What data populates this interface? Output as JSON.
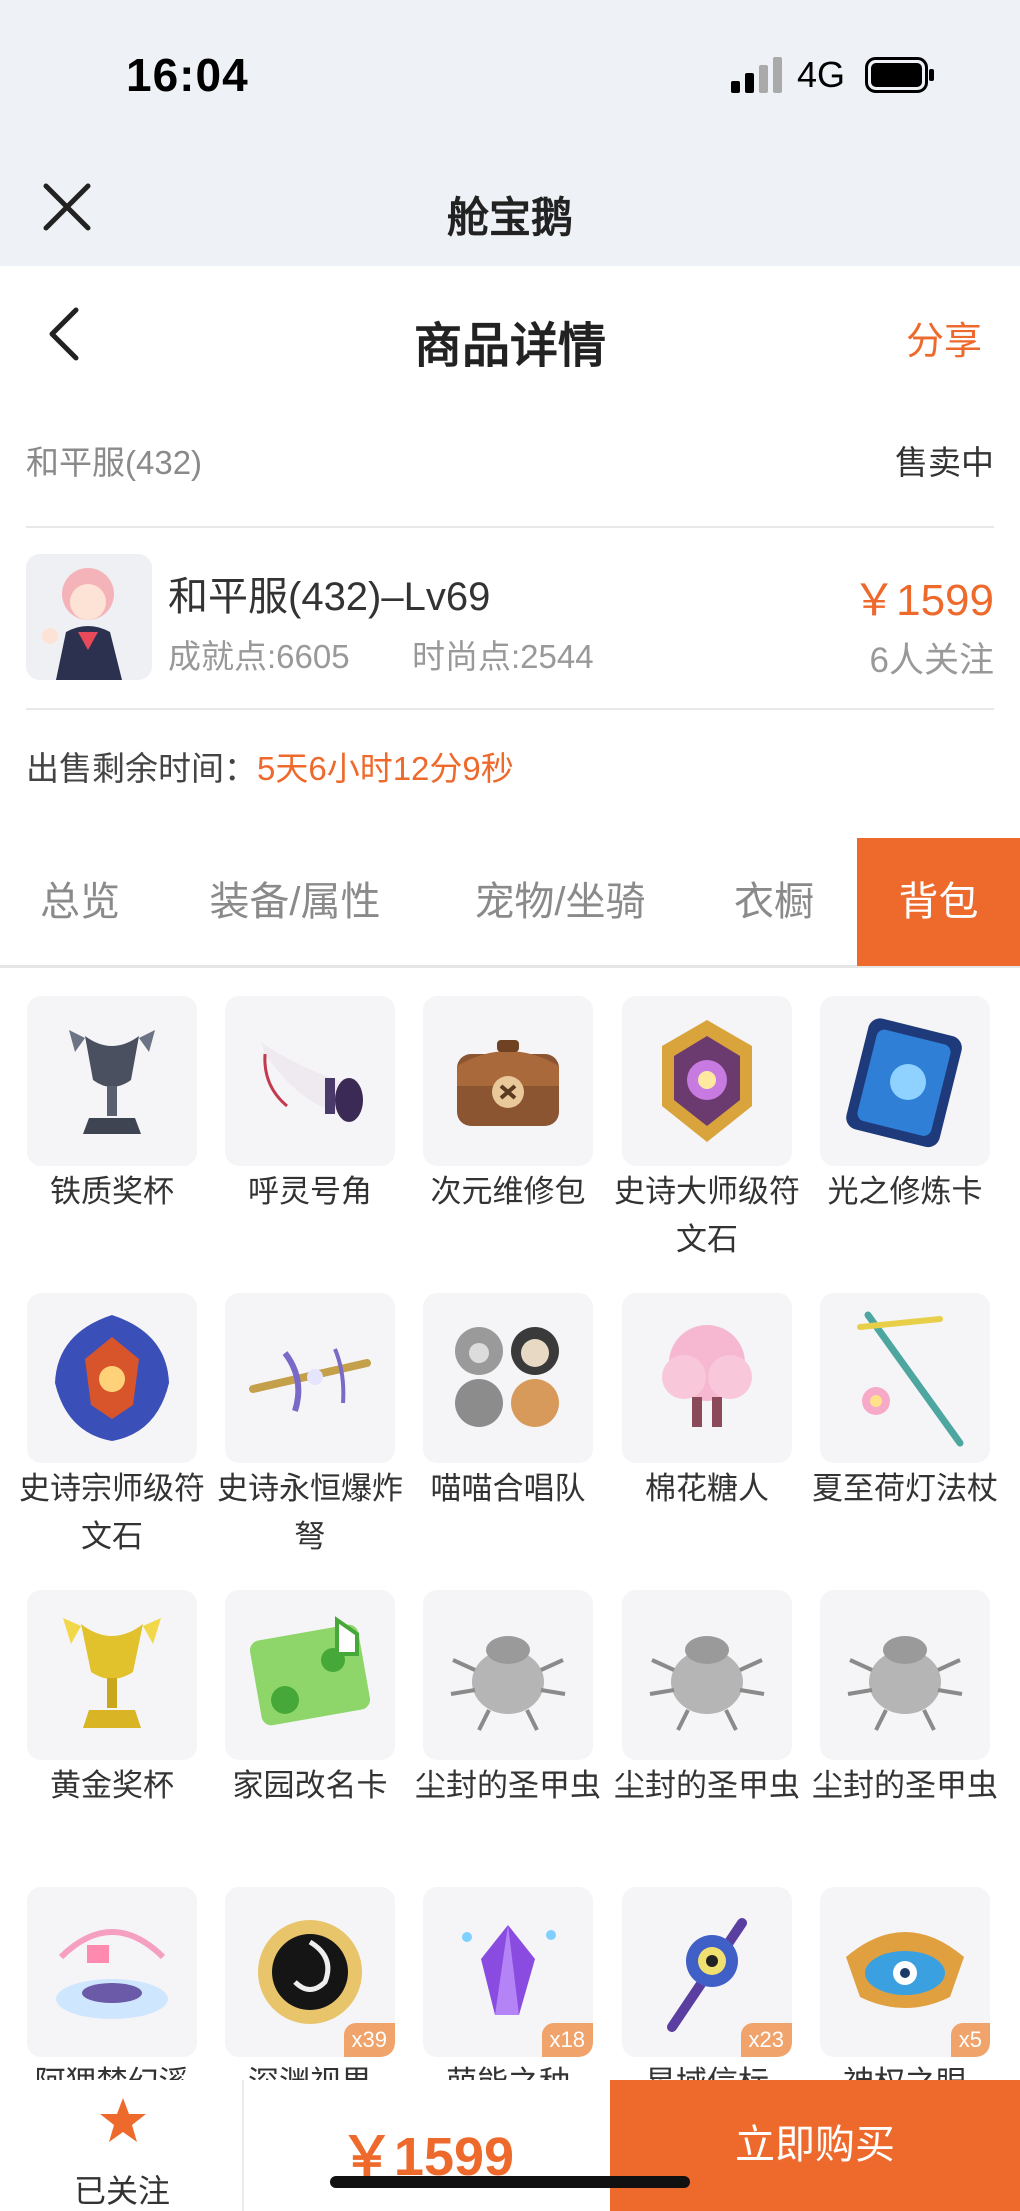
{
  "status_bar": {
    "time": "16:04",
    "network": "4G"
  },
  "app": {
    "title": "舱宝鹅"
  },
  "nav": {
    "title": "商品详情",
    "share": "分享"
  },
  "server": {
    "name": "和平服(432)",
    "status": "售卖中"
  },
  "item": {
    "title": "和平服(432)–Lv69",
    "achievement": "成就点:6605",
    "fashion": "时尚点:2544",
    "price": "￥1599",
    "followers": "6人关注"
  },
  "sale_time": {
    "label": "出售剩余时间：",
    "value": "5天6小时12分9秒"
  },
  "tabs": [
    {
      "label": "总览",
      "active": false
    },
    {
      "label": "装备/属性",
      "active": false
    },
    {
      "label": "宠物/坐骑",
      "active": false
    },
    {
      "label": "衣橱",
      "active": false
    },
    {
      "label": "背包",
      "active": true
    }
  ],
  "inventory": [
    {
      "name": "铁质奖杯",
      "icon": "iron-trophy-icon",
      "qty": ""
    },
    {
      "name": "呼灵号角",
      "icon": "horn-icon",
      "qty": ""
    },
    {
      "name": "次元维修包",
      "icon": "repair-bag-icon",
      "qty": ""
    },
    {
      "name": "史诗大师级符文石",
      "icon": "master-rune-icon",
      "qty": ""
    },
    {
      "name": "光之修炼卡",
      "icon": "light-card-icon",
      "qty": ""
    },
    {
      "name": "史诗宗师级符文石",
      "icon": "grandmaster-rune-icon",
      "qty": ""
    },
    {
      "name": "史诗永恒爆炸弩",
      "icon": "crossbow-icon",
      "qty": ""
    },
    {
      "name": "喵喵合唱队",
      "icon": "cat-choir-icon",
      "qty": ""
    },
    {
      "name": "棉花糖人",
      "icon": "marshmallow-icon",
      "qty": ""
    },
    {
      "name": "夏至荷灯法杖",
      "icon": "lotus-staff-icon",
      "qty": ""
    },
    {
      "name": "黄金奖杯",
      "icon": "gold-trophy-icon",
      "qty": ""
    },
    {
      "name": "家园改名卡",
      "icon": "rename-card-icon",
      "qty": ""
    },
    {
      "name": "尘封的圣甲虫",
      "icon": "scarab-icon",
      "qty": ""
    },
    {
      "name": "尘封的圣甲虫",
      "icon": "scarab-icon",
      "qty": ""
    },
    {
      "name": "尘封的圣甲虫",
      "icon": "scarab-icon",
      "qty": ""
    },
    {
      "name": "阿狸梦幻溪",
      "icon": "dream-cloud-icon",
      "qty": ""
    },
    {
      "name": "深渊视界",
      "icon": "abyss-eye-icon",
      "qty": "x39"
    },
    {
      "name": "萌能之种",
      "icon": "purple-crystal-icon",
      "qty": "x18"
    },
    {
      "name": "星域信标",
      "icon": "star-beacon-icon",
      "qty": "x23"
    },
    {
      "name": "神权之眼",
      "icon": "divine-eye-icon",
      "qty": "x5"
    }
  ],
  "bottom": {
    "follow": "已关注",
    "price": "￥1599",
    "buy": "立即购买"
  },
  "colors": {
    "accent": "#ee6a2c"
  }
}
